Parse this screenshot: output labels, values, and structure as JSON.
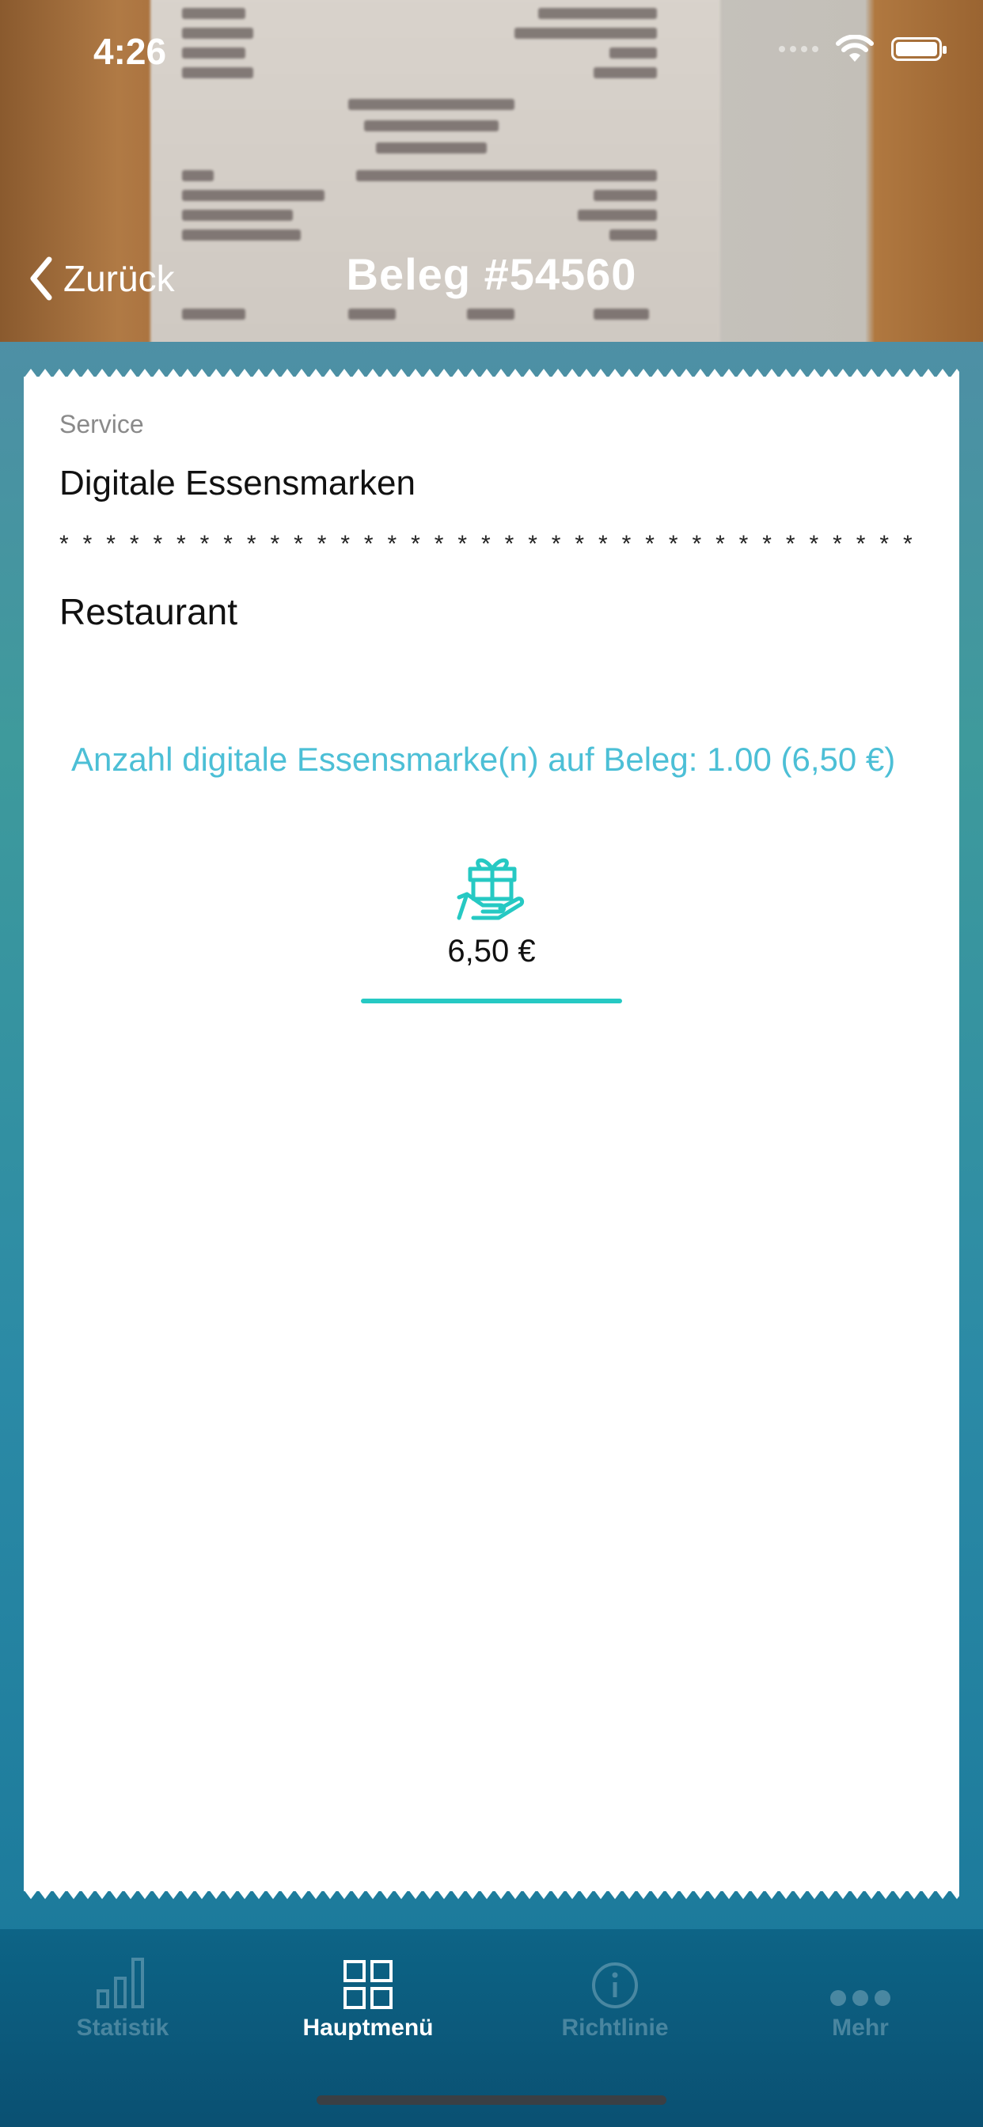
{
  "status": {
    "time": "4:26"
  },
  "nav": {
    "back_label": "Zurück",
    "title": "Beleg #54560"
  },
  "card": {
    "service_label": "Service",
    "service_value": "Digitale Essensmarken",
    "separator": "* * * * * * * * * * * * * * * * * * * * * * * * * * * * * * * * * * * * * * * * * * * * * * * * * * * *",
    "category": "Restaurant",
    "count_text": "Anzahl digitale Essensmarke(n) auf Beleg: 1.00 (6,50 €)",
    "amount": "6,50 €"
  },
  "tabs": [
    {
      "label": "Statistik",
      "icon": "bar-chart-icon",
      "active": false
    },
    {
      "label": "Hauptmenü",
      "icon": "grid-icon",
      "active": true
    },
    {
      "label": "Richtlinie",
      "icon": "info-icon",
      "active": false
    },
    {
      "label": "Mehr",
      "icon": "more-icon",
      "active": false
    }
  ],
  "colors": {
    "accent": "#26c9c3",
    "link": "#4cbfd6",
    "tabbar": "#0a5072"
  }
}
